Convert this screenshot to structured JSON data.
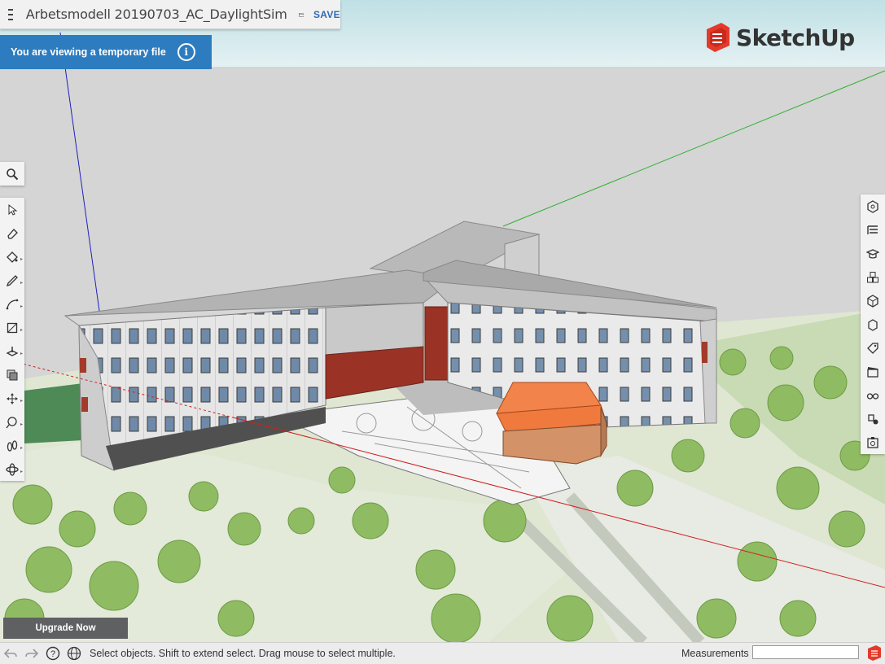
{
  "file": {
    "name": "Arbetsmodell 20190703_AC_DaylightSim",
    "save_label": "SAVE"
  },
  "banner": {
    "text": "You are viewing a temporary file",
    "info_glyph": "i"
  },
  "brand": {
    "name": "SketchUp",
    "color": "#e43a2b"
  },
  "left_toolbar": {
    "search": "search-icon",
    "tools": [
      "select-arrow-icon",
      "eraser-icon",
      "paint-bucket-icon",
      "pencil-icon",
      "arc-icon",
      "rectangle-icon",
      "push-pull-icon",
      "offset-icon",
      "move-icon",
      "tape-measure-icon",
      "walk-icon",
      "orbit-icon"
    ]
  },
  "right_toolbar": {
    "panels": [
      "entity-info-icon",
      "instructor-icon",
      "outliner-icon",
      "components-icon",
      "materials-icon",
      "styles-icon",
      "tags-icon",
      "scenes-icon",
      "display-icon",
      "shadows-icon",
      "solar-north-icon"
    ]
  },
  "upgrade": {
    "label": "Upgrade Now"
  },
  "statusbar": {
    "hint": "Select objects. Shift to extend select. Drag mouse to select multiple.",
    "measurements_label": "Measurements",
    "measurements_value": ""
  },
  "colors": {
    "accent": "#2d7cc0",
    "save": "#2f6ab3",
    "axis_red": "#d02020",
    "axis_green": "#2db02d",
    "axis_blue": "#2020c0"
  }
}
